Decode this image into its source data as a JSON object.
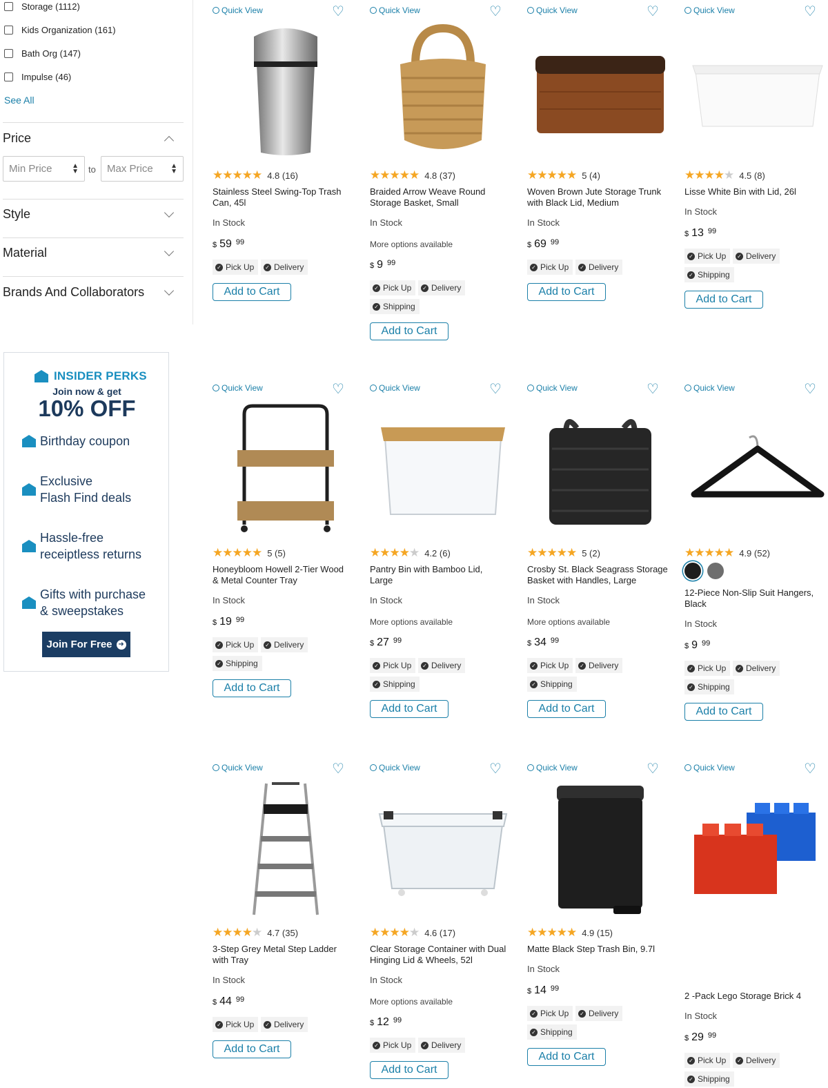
{
  "sidebar": {
    "categories": [
      {
        "label": "Storage (1112)"
      },
      {
        "label": "Kids Organization (161)"
      },
      {
        "label": "Bath Org (147)"
      },
      {
        "label": "Impulse (46)"
      }
    ],
    "see_all": "See All",
    "price_title": "Price",
    "min_price_placeholder": "Min Price",
    "to_label": "to",
    "max_price_placeholder": "Max Price",
    "style_title": "Style",
    "material_title": "Material",
    "brands_title": "Brands And Collaborators"
  },
  "perks": {
    "title": "INSIDER PERKS",
    "join_now": "Join now & get",
    "discount": "10% OFF",
    "items": [
      {
        "line1": "Birthday coupon",
        "line2": ""
      },
      {
        "line1": "Exclusive",
        "line2": "Flash Find deals"
      },
      {
        "line1": "Hassle-free",
        "line2": "receiptless returns"
      },
      {
        "line1": "Gifts with purchase",
        "line2": "& sweepstakes"
      }
    ],
    "join_button": "Join For Free",
    "accent_color": "#1a8fc0",
    "navy_color": "#1b3d63"
  },
  "labels": {
    "quick_view": "Quick View",
    "in_stock": "In Stock",
    "more_options": "More options available",
    "pick_up": "Pick Up",
    "delivery": "Delivery",
    "shipping": "Shipping",
    "add_to_cart": "Add to Cart",
    "currency": "$"
  },
  "products": [
    {
      "name_l1": "Stainless Steel Swing-Top Trash",
      "name_l2": "Can, 45l",
      "rating": 4.8,
      "rating_text": "4.8 (16)",
      "dollars": "59",
      "cents": "99",
      "icon": "trash-can-image"
    },
    {
      "name_l1": "Braided Arrow Weave Round",
      "name_l2": "Storage Basket, Small",
      "rating": 4.8,
      "rating_text": "4.8 (37)",
      "dollars": "9",
      "cents": "99",
      "icon": "woven-basket-image"
    },
    {
      "name_l1": "Woven Brown Jute Storage Trunk",
      "name_l2": "with Black Lid, Medium",
      "rating": 5,
      "rating_text": "5 (4)",
      "dollars": "69",
      "cents": "99",
      "icon": "storage-trunk-image"
    },
    {
      "name_l1": "Lisse White Bin with Lid, 26l",
      "name_l2": "",
      "rating": 4.5,
      "rating_text": "4.5 (8)",
      "dollars": "13",
      "cents": "99",
      "icon": "white-bin-image"
    },
    {
      "name_l1": "Honeybloom Howell 2-Tier Wood",
      "name_l2": "& Metal Counter Tray",
      "rating": 5,
      "rating_text": "5 (5)",
      "dollars": "19",
      "cents": "99",
      "icon": "tier-tray-image"
    },
    {
      "name_l1": "Pantry Bin with Bamboo Lid,",
      "name_l2": "Large",
      "rating": 4.2,
      "rating_text": "4.2 (6)",
      "dollars": "27",
      "cents": "99",
      "icon": "pantry-bin-image"
    },
    {
      "name_l1": "Crosby St. Black Seagrass Storage",
      "name_l2": "Basket with Handles, Large",
      "rating": 5,
      "rating_text": "5 (2)",
      "dollars": "34",
      "cents": "99",
      "icon": "black-basket-image"
    },
    {
      "name_l1": "12-Piece Non-Slip Suit Hangers,",
      "name_l2": "Black",
      "rating": 4.9,
      "rating_text": "4.9 (52)",
      "dollars": "9",
      "cents": "99",
      "icon": "hanger-image",
      "swatch_colors": [
        "#1e1e1e",
        "#6e6e6e"
      ]
    },
    {
      "name_l1": "3-Step Grey Metal Step Ladder",
      "name_l2": "with Tray",
      "rating": 4.7,
      "rating_text": "4.7 (35)",
      "dollars": "44",
      "cents": "99",
      "icon": "step-ladder-image"
    },
    {
      "name_l1": "Clear Storage Container with Dual",
      "name_l2": "Hinging Lid & Wheels, 52l",
      "rating": 4.6,
      "rating_text": "4.6 (17)",
      "dollars": "12",
      "cents": "99",
      "icon": "clear-container-image"
    },
    {
      "name_l1": "Matte Black Step Trash Bin, 9.7l",
      "name_l2": "",
      "rating": 4.9,
      "rating_text": "4.9 (15)",
      "dollars": "14",
      "cents": "99",
      "icon": "step-bin-image"
    },
    {
      "name_l1": "2 -Pack Lego Storage Brick 4",
      "name_l2": "",
      "rating": null,
      "rating_text": "",
      "dollars": "29",
      "cents": "99",
      "icon": "lego-brick-image"
    }
  ]
}
